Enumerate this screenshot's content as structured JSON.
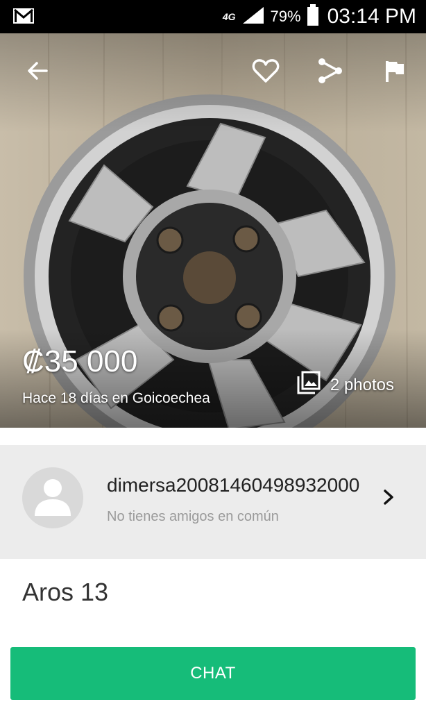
{
  "status_bar": {
    "network": "4G",
    "battery": "79%",
    "time": "03:14 PM",
    "icons": [
      "gmail-icon",
      "signal-icon",
      "battery-icon"
    ]
  },
  "listing": {
    "price": "₡35 000",
    "posted": "Hace 18 días en Goicoechea",
    "photos_label": "2 photos",
    "title": "Aros 13"
  },
  "toolbar": {
    "icons": [
      "back-arrow-icon",
      "heart-icon",
      "share-icon",
      "flag-icon"
    ]
  },
  "seller": {
    "username": "dimersa20081460498932000",
    "mutual_friends": "No tienes amigos en común"
  },
  "actions": {
    "chat_label": "CHAT"
  },
  "colors": {
    "chat_button": "#16bc79",
    "seller_card_bg": "#ececec"
  }
}
